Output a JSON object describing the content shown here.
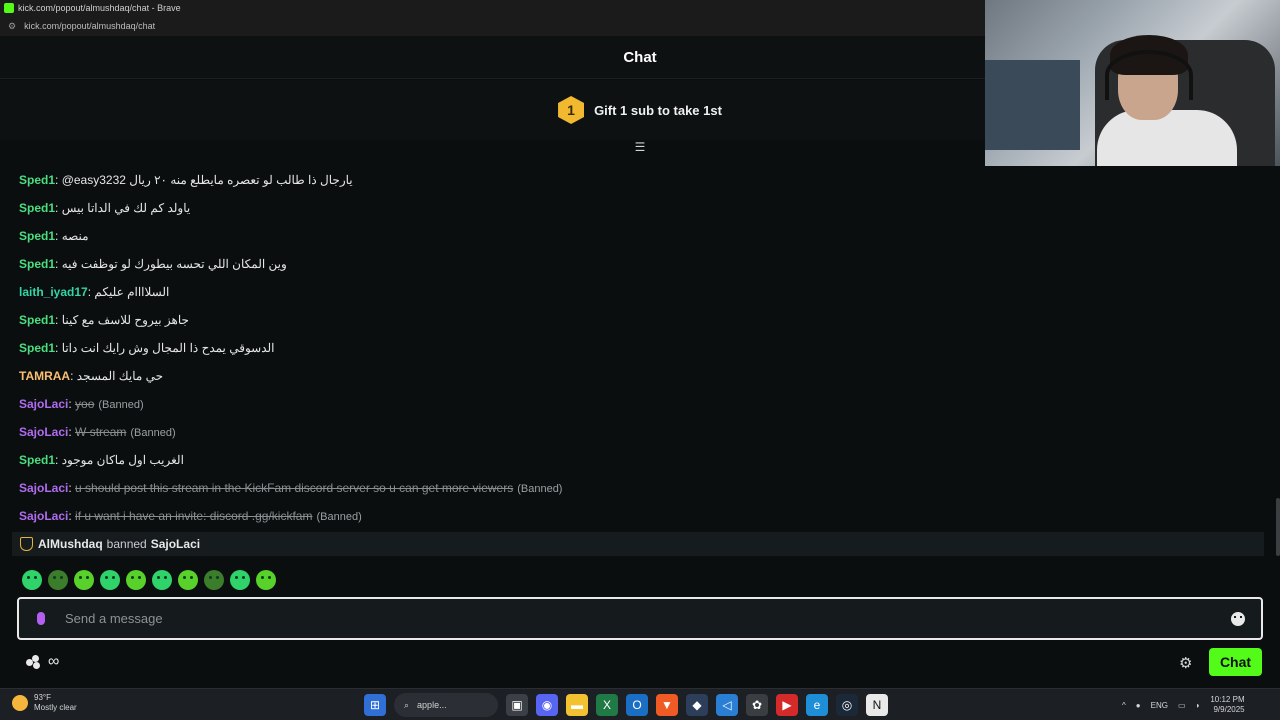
{
  "window": {
    "title": "kick.com/popout/almushdaq/chat - Brave",
    "url": "kick.com/popout/almushdaq/chat"
  },
  "header": {
    "title": "Chat"
  },
  "gift": {
    "badge_number": "1",
    "text": "Gift 1 sub to take 1st"
  },
  "colors": {
    "kick_green": "#53fc18",
    "sped_green": "#4ade80",
    "laith_teal": "#34d4a4",
    "tamraa_orange": "#fbbf72",
    "sajo_purple": "#b06cf0"
  },
  "messages": [
    {
      "user": "Sped1",
      "sep": ": ",
      "text": "@easy3232 يارجال ذا طالب لو تعصره مايطلع منه ٢٠ ريال",
      "banned": "",
      "is_banned": false,
      "color": "#4ade80"
    },
    {
      "user": "Sped1",
      "sep": ": ",
      "text": "ياولد كم لك في الداتا بيس",
      "banned": "",
      "is_banned": false,
      "color": "#4ade80"
    },
    {
      "user": "Sped1",
      "sep": ": ",
      "text": "منصه",
      "banned": "",
      "is_banned": false,
      "color": "#4ade80"
    },
    {
      "user": "Sped1",
      "sep": ": ",
      "text": "وين المكان اللي تحسه بيطورك لو توظفت فيه",
      "banned": "",
      "is_banned": false,
      "color": "#4ade80"
    },
    {
      "user": "laith_iyad17",
      "sep": ": ",
      "text": "السلاااام عليكم",
      "banned": "",
      "is_banned": false,
      "color": "#34d4a4"
    },
    {
      "user": "Sped1",
      "sep": ": ",
      "text": "جاهز بيروح للاسف مع كينا",
      "banned": "",
      "is_banned": false,
      "color": "#4ade80"
    },
    {
      "user": "Sped1",
      "sep": ": ",
      "text": "الدسوقي يمدح ذا المجال وش رايك انت داتا",
      "banned": "",
      "is_banned": false,
      "color": "#4ade80"
    },
    {
      "user": "TAMRAA",
      "sep": ": ",
      "text": "حي مايك المسجد",
      "banned": "",
      "is_banned": false,
      "color": "#fbbf72"
    },
    {
      "user": "SajoLaci",
      "sep": ": ",
      "text": "yoo",
      "banned": "(Banned)",
      "is_banned": true,
      "color": "#b06cf0"
    },
    {
      "user": "SajoLaci",
      "sep": ": ",
      "text": "W stream",
      "banned": "(Banned)",
      "is_banned": true,
      "color": "#b06cf0"
    },
    {
      "user": "Sped1",
      "sep": ": ",
      "text": "الغريب اول ماكان موجود",
      "banned": "",
      "is_banned": false,
      "color": "#4ade80"
    },
    {
      "user": "SajoLaci",
      "sep": ": ",
      "text": "u should post this stream in the KickFam discord server so u can get more viewers",
      "banned": "(Banned)",
      "is_banned": true,
      "color": "#b06cf0"
    },
    {
      "user": "SajoLaci",
      "sep": ": ",
      "text": "if u want i have an invite: discord .gg/kickfam",
      "banned": "(Banned)",
      "is_banned": true,
      "color": "#b06cf0"
    }
  ],
  "ban_notice": {
    "moderator": "AlMushdaq",
    "action": "banned",
    "target": "SajoLaci"
  },
  "input": {
    "placeholder": "Send a message",
    "value": ""
  },
  "footer": {
    "infinity": "∞",
    "chat_button": "Chat"
  },
  "taskbar": {
    "temperature": "93°F",
    "weather": "Mostly clear",
    "search": "apple...",
    "language": "ENG",
    "time": "10:12 PM",
    "date": "9/9/2025"
  }
}
